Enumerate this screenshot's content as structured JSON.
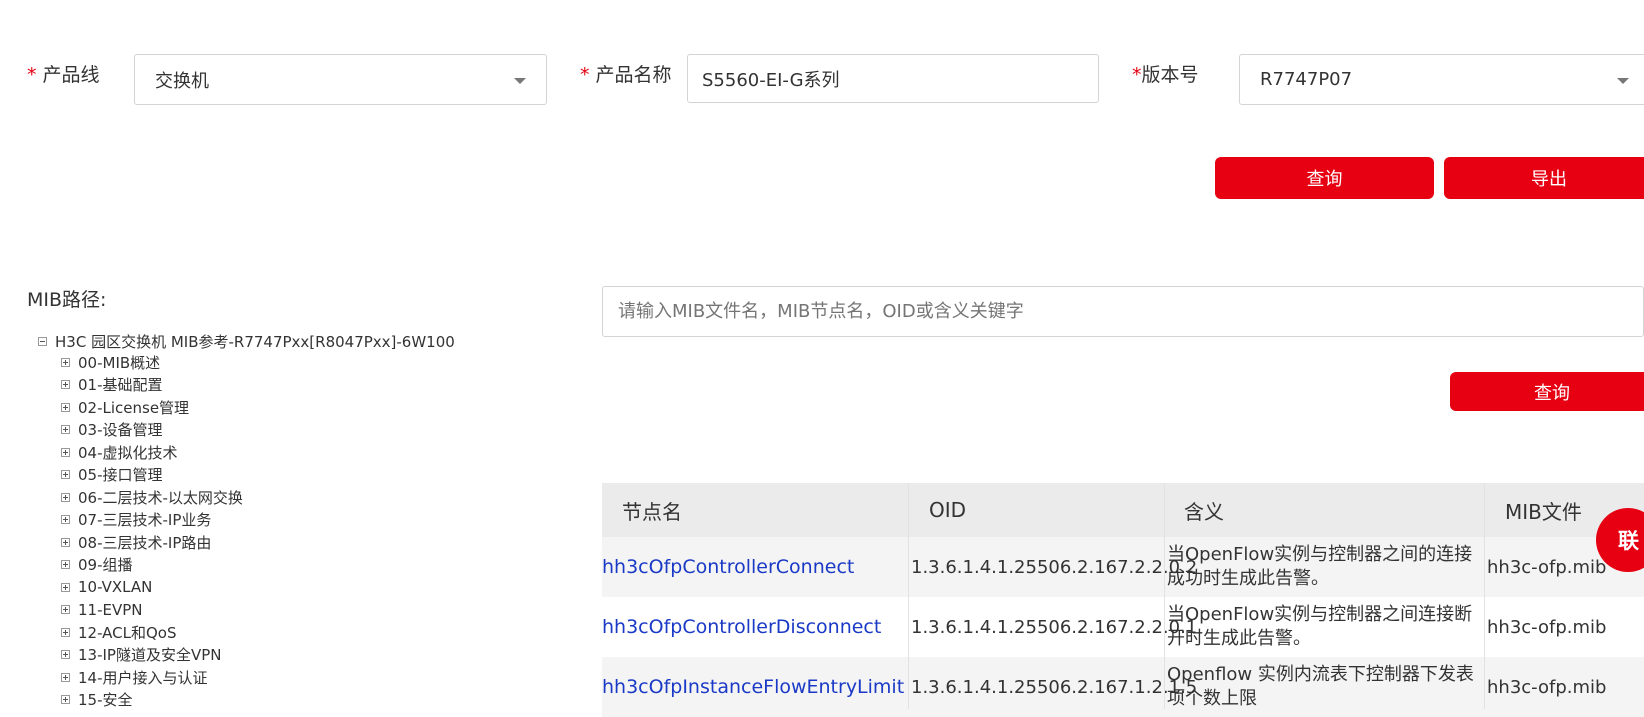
{
  "form": {
    "product_line": {
      "asterisk": "*",
      "label": "产品线",
      "value": "交换机"
    },
    "product_name": {
      "asterisk": "*",
      "label": "产品名称",
      "value": "S5560-EI-G系列"
    },
    "version": {
      "asterisk": "*",
      "label": "版本号",
      "value": "R7747P07"
    },
    "query_button": "查询",
    "export_button": "导出"
  },
  "mib_path_label": "MIB路径:",
  "tree": {
    "root": "H3C 园区交换机 MIB参考-R7747Pxx[R8047Pxx]-6W100",
    "items": [
      "00-MIB概述",
      "01-基础配置",
      "02-License管理",
      "03-设备管理",
      "04-虚拟化技术",
      "05-接口管理",
      "06-二层技术-以太网交换",
      "07-三层技术-IP业务",
      "08-三层技术-IP路由",
      "09-组播",
      "10-VXLAN",
      "11-EVPN",
      "12-ACL和QoS",
      "13-IP隧道及安全VPN",
      "14-用户接入与认证",
      "15-安全"
    ]
  },
  "search": {
    "placeholder": "请输入MIB文件名，MIB节点名，OID或含义关键字",
    "button": "查询"
  },
  "table": {
    "headers": {
      "node": "节点名",
      "oid": "OID",
      "meaning": "含义",
      "mib": "MIB文件"
    },
    "rows": [
      {
        "node": "hh3cOfpControllerConnect",
        "oid": "1.3.6.1.4.1.25506.2.167.2.2.0.2",
        "meaning": "当OpenFlow实例与控制器之间的连接成功时生成此告警。",
        "mib": "hh3c-ofp.mib"
      },
      {
        "node": "hh3cOfpControllerDisconnect",
        "oid": "1.3.6.1.4.1.25506.2.167.2.2.0.1",
        "meaning": "当OpenFlow实例与控制器之间连接断开时生成此告警。",
        "mib": "hh3c-ofp.mib"
      },
      {
        "node": "hh3cOfpInstanceFlowEntryLimit",
        "oid": "1.3.6.1.4.1.25506.2.167.1.2.1.5",
        "meaning": "Openflow 实例内流表下控制器下发表项个数上限",
        "mib": "hh3c-ofp.mib"
      }
    ]
  },
  "floating_contact": "联",
  "colors": {
    "accent": "#e60012",
    "link": "#1a39c6"
  }
}
